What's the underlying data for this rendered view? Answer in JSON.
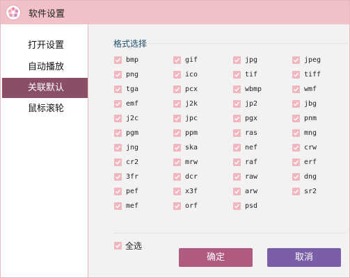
{
  "window": {
    "title": "软件设置"
  },
  "sidebar": {
    "items": [
      {
        "label": "打开设置",
        "active": false
      },
      {
        "label": "自动播放",
        "active": false
      },
      {
        "label": "关联默认",
        "active": true
      },
      {
        "label": "鼠标滚轮",
        "active": false
      }
    ]
  },
  "formats": {
    "group_title": "格式选择",
    "items": [
      "bmp",
      "gif",
      "jpg",
      "jpeg",
      "png",
      "ico",
      "tif",
      "tiff",
      "tga",
      "pcx",
      "wbmp",
      "wmf",
      "emf",
      "j2k",
      "jp2",
      "jbg",
      "j2c",
      "jpc",
      "pgx",
      "pnm",
      "pgm",
      "ppm",
      "ras",
      "mng",
      "jng",
      "ska",
      "nef",
      "crw",
      "cr2",
      "mrw",
      "raf",
      "erf",
      "3fr",
      "dcr",
      "raw",
      "dng",
      "pef",
      "x3f",
      "arw",
      "sr2",
      "mef",
      "orf",
      "psd"
    ],
    "all_checked": true
  },
  "select_all": {
    "label": "全选",
    "checked": true
  },
  "buttons": {
    "ok": "确定",
    "cancel": "取消"
  },
  "colors": {
    "titlebar": "#f2c1c7",
    "active_item": "#8a4f67",
    "checkbox": "#f0b8be",
    "ok_button": "#b05a82",
    "cancel_button": "#7a5fa8",
    "group_title": "#1c4e6e"
  }
}
